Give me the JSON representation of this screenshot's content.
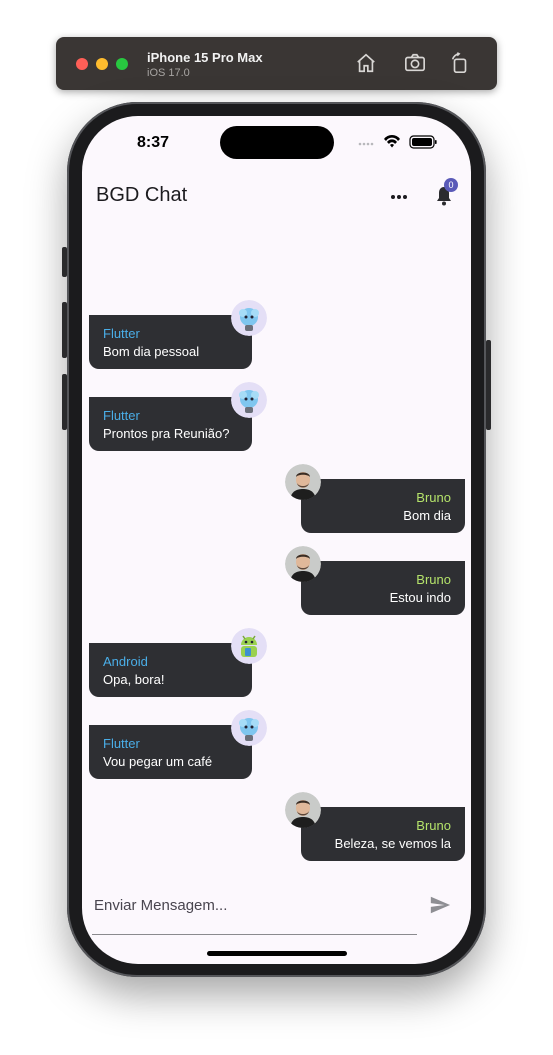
{
  "simulator": {
    "device_name": "iPhone 15 Pro Max",
    "os_version": "iOS 17.0",
    "icons": [
      "home-icon",
      "screenshot-icon",
      "rotate-icon"
    ]
  },
  "status_bar": {
    "time": "8:37"
  },
  "app_bar": {
    "title": "BGD Chat",
    "notification_count": "0",
    "icons": [
      "more-horizontal-icon",
      "bell-icon"
    ]
  },
  "messages": [
    {
      "sender": "Flutter",
      "text": "Bom dia pessoal",
      "side": "left",
      "avatar": "flutter-mascot"
    },
    {
      "sender": "Flutter",
      "text": "Prontos pra Reunião?",
      "side": "left",
      "avatar": "flutter-mascot"
    },
    {
      "sender": "Bruno",
      "text": "Bom dia",
      "side": "right",
      "avatar": "bruno-photo"
    },
    {
      "sender": "Bruno",
      "text": "Estou indo",
      "side": "right",
      "avatar": "bruno-photo"
    },
    {
      "sender": "Android",
      "text": "Opa, bora!",
      "side": "left",
      "avatar": "android-mascot"
    },
    {
      "sender": "Flutter",
      "text": "Vou pegar um café",
      "side": "left",
      "avatar": "flutter-mascot"
    },
    {
      "sender": "Bruno",
      "text": "Beleza, se vemos la",
      "side": "right",
      "avatar": "bruno-photo"
    }
  ],
  "composer": {
    "placeholder": "Enviar Mensagem...",
    "value": "",
    "send_icon": "send-icon"
  },
  "colors": {
    "bubble": "#2e2f33",
    "left_sender": "#4aaee8",
    "right_sender": "#b4e26a",
    "badge": "#5a5ab8",
    "screen_bg": "#fcf8fd"
  }
}
